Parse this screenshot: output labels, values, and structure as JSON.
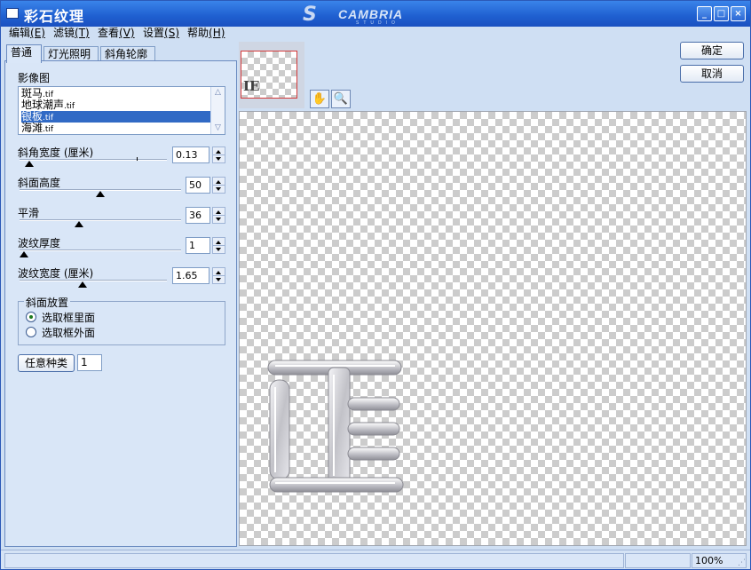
{
  "window": {
    "title": "彩石纹理",
    "brand": "CAMBRIA",
    "brand_sub": "STUDIO",
    "min_label": "_",
    "max_label": "□",
    "close_label": "×"
  },
  "menu": [
    {
      "label": "编辑",
      "key": "(E)"
    },
    {
      "label": "滤镜",
      "key": "(T)"
    },
    {
      "label": "查看",
      "key": "(V)"
    },
    {
      "label": "设置",
      "key": "(S)"
    },
    {
      "label": "帮助",
      "key": "(H)"
    }
  ],
  "tabs": [
    "普通",
    "灯光照明",
    "斜角轮廓"
  ],
  "panel": {
    "image_label": "影像图",
    "image_list": [
      {
        "name": "斑马",
        "ext": ".tif"
      },
      {
        "name": "地球潮声",
        "ext": ".tif"
      },
      {
        "name": "银板",
        "ext": ".tif"
      },
      {
        "name": "海滩",
        "ext": ".tif"
      }
    ],
    "selected_index": 2,
    "list_up": "△",
    "list_down": "▽",
    "params": [
      {
        "label": "斜角宽度 (厘米)",
        "value": "0.13"
      },
      {
        "label": "斜面高度",
        "value": "50"
      },
      {
        "label": "平滑",
        "value": "36"
      },
      {
        "label": "波纹厚度",
        "value": "1"
      },
      {
        "label": "波纹宽度 (厘米)",
        "value": "1.65"
      }
    ],
    "bevel_group_title": "斜面放置",
    "radio_inside": "选取框里面",
    "radio_outside": "选取框外面",
    "random_button": "任意种类",
    "random_value": "1"
  },
  "thumbnail": {
    "text": "IE"
  },
  "tools": {
    "hand_icon": "✋",
    "zoom_icon": "🔍"
  },
  "buttons": {
    "ok": "确定",
    "cancel": "取消"
  },
  "status": {
    "zoom": "100%"
  },
  "colors": {
    "titlebar": "#1f5fd0",
    "panel": "#d9e6f7",
    "selection": "#316ac5"
  }
}
